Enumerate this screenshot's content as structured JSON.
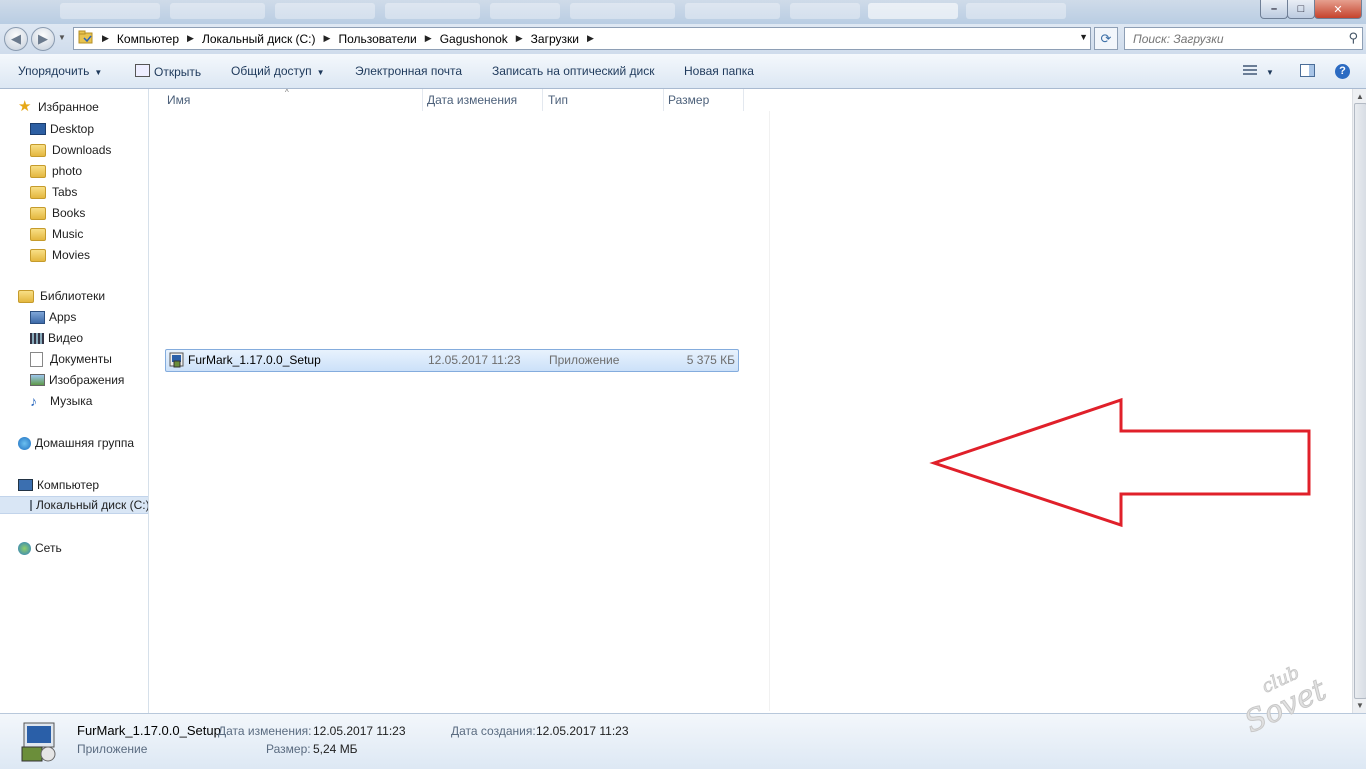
{
  "window": {
    "controls": {
      "minimize": "–",
      "maximize": "□",
      "close": "✕"
    }
  },
  "nav": {
    "back_icon": "back-arrow-icon",
    "forward_icon": "forward-arrow-icon",
    "breadcrumbs": [
      "Компьютер",
      "Локальный диск (C:)",
      "Пользователи",
      "Gagushonok",
      "Загрузки"
    ],
    "search_placeholder": "Поиск: Загрузки"
  },
  "commands": {
    "organize": "Упорядочить",
    "open": "Открыть",
    "share": "Общий доступ",
    "email": "Электронная почта",
    "burn": "Записать на оптический диск",
    "new_folder": "Новая папка"
  },
  "sidebar": {
    "favorites": {
      "label": "Избранное",
      "items": [
        "Desktop",
        "Downloads",
        "photo",
        "Tabs",
        "Books",
        "Music",
        "Movies"
      ]
    },
    "libraries": {
      "label": "Библиотеки",
      "items": [
        "Apps",
        "Видео",
        "Документы",
        "Изображения",
        "Музыка"
      ]
    },
    "homegroup": "Домашняя группа",
    "computer": {
      "label": "Компьютер",
      "items": [
        "Локальный диск (C:)"
      ]
    },
    "network": "Сеть"
  },
  "columns": [
    "Имя",
    "Дата изменения",
    "Тип",
    "Размер"
  ],
  "files": [
    {
      "name": "FurMark_1.17.0.0_Setup",
      "modified": "12.05.2017 11:23",
      "type": "Приложение",
      "size": "5 375 КБ"
    }
  ],
  "details": {
    "name": "FurMark_1.17.0.0_Setup",
    "type": "Приложение",
    "modified_label": "Дата изменения:",
    "modified": "12.05.2017 11:23",
    "size_label": "Размер:",
    "size": "5,24 МБ",
    "created_label": "Дата создания:",
    "created": "12.05.2017 11:23"
  },
  "annotation": {
    "color": "#e0202a"
  },
  "watermark": "club Sovet"
}
